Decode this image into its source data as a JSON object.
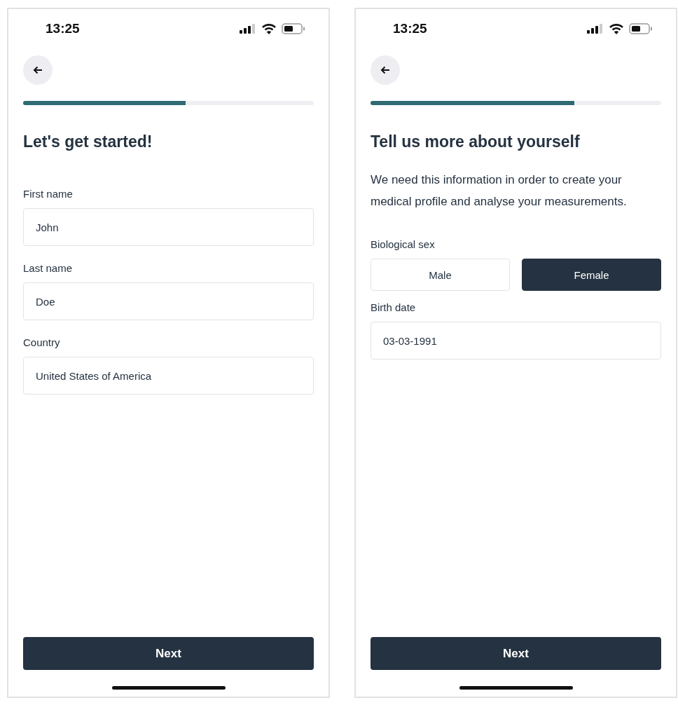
{
  "screens": [
    {
      "status_time": "13:25",
      "progress": {
        "level": 0.56
      },
      "title": "Let's get started!",
      "fields": [
        {
          "kind": "text",
          "label": "First name",
          "value": "John"
        },
        {
          "kind": "text",
          "label": "Last name",
          "value": "Doe"
        },
        {
          "kind": "text",
          "label": "Country",
          "value": "United States of America"
        }
      ],
      "next_button": "Next"
    },
    {
      "status_time": "13:25",
      "progress": {
        "level": 0.7
      },
      "title": "Tell us more about yourself",
      "description": "We need this information in order to create your medical profile and analyse your measurements.",
      "fields": [
        {
          "kind": "choice",
          "label": "Biological sex",
          "options": [
            {
              "label": "Male",
              "selected": false
            },
            {
              "label": "Female",
              "selected": true
            }
          ]
        },
        {
          "kind": "text",
          "label": "Birth date",
          "value": "03-03-1991"
        }
      ],
      "next_button": "Next"
    }
  ]
}
